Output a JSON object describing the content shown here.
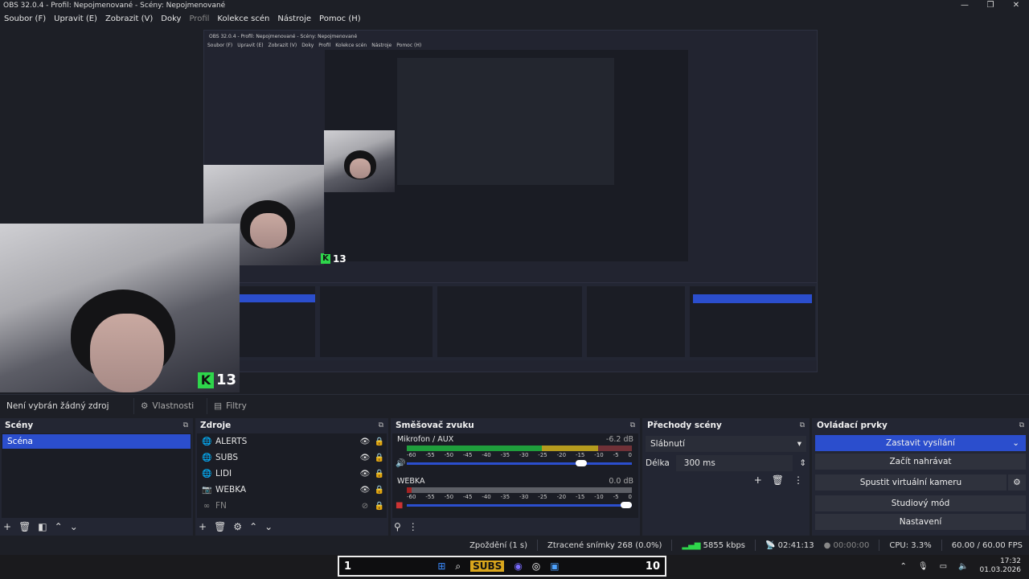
{
  "window": {
    "title": "OBS 32.0.4 - Profil: Nepojmenované - Scény: Nepojmenované",
    "controls": [
      "—",
      "❐",
      "✕"
    ]
  },
  "menu": {
    "items": [
      "Soubor (F)",
      "Upravit (E)",
      "Zobrazit (V)",
      "Doky",
      "Profil",
      "Kolekce scén",
      "Nástroje",
      "Pomoc (H)"
    ]
  },
  "preview": {
    "nested_title": "OBS 32.0.4 - Profil: Nepojmenované - Scény: Nepojmenované",
    "badge_count": "13"
  },
  "source_bar": {
    "no_selection": "Není vybrán žádný zdroj",
    "properties": "Vlastnosti",
    "filters": "Filtry"
  },
  "scenes": {
    "title": "Scény",
    "items": [
      "Scéna"
    ]
  },
  "sources": {
    "title": "Zdroje",
    "items": [
      {
        "name": "ALERTS",
        "icon": "globe-icon"
      },
      {
        "name": "SUBS",
        "icon": "globe-icon"
      },
      {
        "name": "LIDI",
        "icon": "globe-icon"
      },
      {
        "name": "WEBKA",
        "icon": "camera-icon"
      },
      {
        "name": "FN",
        "icon": "link-icon",
        "hidden": true
      }
    ]
  },
  "mixer": {
    "title": "Směšovač zvuku",
    "channels": [
      {
        "name": "Mikrofon / AUX",
        "db": "-6.2 dB",
        "level": 0.85
      },
      {
        "name": "WEBKA",
        "db": "0.0 dB",
        "level": 0.0
      }
    ],
    "ticks": [
      "-60",
      "-55",
      "-50",
      "-45",
      "-40",
      "-35",
      "-30",
      "-25",
      "-20",
      "-15",
      "-10",
      "-5",
      "0"
    ]
  },
  "transitions": {
    "title": "Přechody scény",
    "selected": "Slábnutí",
    "duration_label": "Délka",
    "duration": "300 ms"
  },
  "controls": {
    "title": "Ovládací prvky",
    "stop_stream": "Zastavit vysílání",
    "start_recording": "Začít nahrávat",
    "virtual_cam": "Spustit virtuální kameru",
    "studio_mode": "Studiový mód",
    "settings": "Nastavení"
  },
  "status": {
    "delay": "Zpoždění (1 s)",
    "dropped": "Ztracené snímky 268 (0.0%)",
    "bitrate": "5855 kbps",
    "stream_time": "02:41:13",
    "rec_time": "00:00:00",
    "cpu": "CPU: 3.3%",
    "fps": "60.00 / 60.00 FPS"
  },
  "taskbar": {
    "left_num": "1",
    "right_num": "10",
    "subs": "SUBS",
    "time": "17:32",
    "date": "01.03.2026"
  },
  "colors": {
    "accent": "#2b4ecd",
    "meter_green": "#1f9e3c",
    "meter_yellow": "#b59b1e",
    "meter_red": "#a32323",
    "badge_green": "#2ed64b"
  }
}
